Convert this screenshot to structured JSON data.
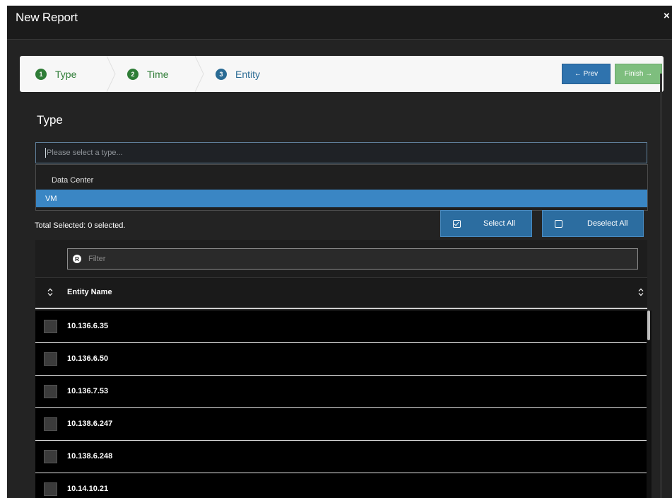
{
  "modal": {
    "title": "New Report",
    "close": "×"
  },
  "wizard": {
    "steps": [
      {
        "num": "1",
        "label": "Type"
      },
      {
        "num": "2",
        "label": "Time"
      },
      {
        "num": "3",
        "label": "Entity"
      }
    ],
    "prev_label": "← Prev",
    "finish_label": "Finish →"
  },
  "type_section": {
    "title": "Type",
    "placeholder": "Please select a type...",
    "options": [
      "Data Center",
      "VM"
    ]
  },
  "selection": {
    "total": "Total Selected: 0 selected.",
    "select_all": "Select All",
    "deselect_all": "Deselect All"
  },
  "table": {
    "filter_placeholder": "Filter",
    "filter_icon": "R",
    "column": "Entity Name",
    "rows": [
      "10.136.6.35",
      "10.136.6.50",
      "10.136.7.53",
      "10.138.6.247",
      "10.138.6.248",
      "10.14.10.21"
    ]
  }
}
